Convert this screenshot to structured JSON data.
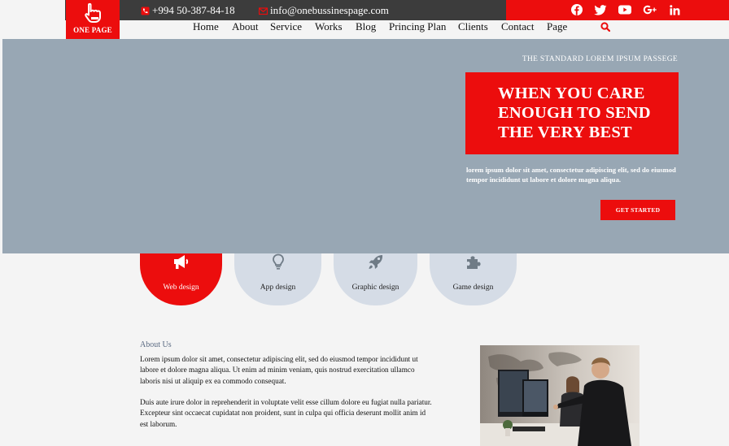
{
  "brand": {
    "logo_text": "ONE PAGE",
    "color_red": "#ec0d0d",
    "color_dark": "#3c3c3c"
  },
  "topbar": {
    "phone": "+994 50-387-84-18",
    "email": "info@onebussinespage.com",
    "social": [
      "facebook-icon",
      "twitter-icon",
      "youtube-icon",
      "google-plus-icon",
      "linkedin-icon"
    ]
  },
  "nav": {
    "items": [
      "Home",
      "About",
      "Service",
      "Works",
      "Blog",
      "Princing Plan",
      "Clients",
      "Contact",
      "Page"
    ]
  },
  "hero": {
    "kicker": "THE STANDARD LOREM IPSUM PASSEGE",
    "title_lines": [
      "WHEN YOU CARE",
      "ENOUGH TO SEND",
      "THE VERY BEST"
    ],
    "body": "lorem ipsum dolor sit amet, consectetur adipiscing elit, sed do eiusmod tempor incididunt ut labore et dolore magna aliqua.",
    "cta": "GET STARTED",
    "background": "#98a7b4"
  },
  "services": [
    {
      "label": "Web design",
      "icon": "megaphone-icon",
      "active": true
    },
    {
      "label": "App design",
      "icon": "lightbulb-icon",
      "active": false
    },
    {
      "label": "Graphic design",
      "icon": "rocket-icon",
      "active": false
    },
    {
      "label": "Game design",
      "icon": "puzzle-icon",
      "active": false
    }
  ],
  "about": {
    "heading": "About Us",
    "p1": "Lorem ipsum dolor sit amet, consectetur adipiscing elit, sed do eiusmod tempor incididunt ut labore et dolore magna aliqua. Ut enim ad minim veniam, quis nostrud exercitation ullamco laboris nisi ut aliquip ex ea commodo consequat.",
    "p2": "Duis aute irure dolor in reprehenderit in voluptate velit esse cillum dolore eu fugiat nulla pariatur. Excepteur sint occaecat cupidatat non proident, sunt in culpa qui officia deserunt mollit anim id est laborum."
  }
}
